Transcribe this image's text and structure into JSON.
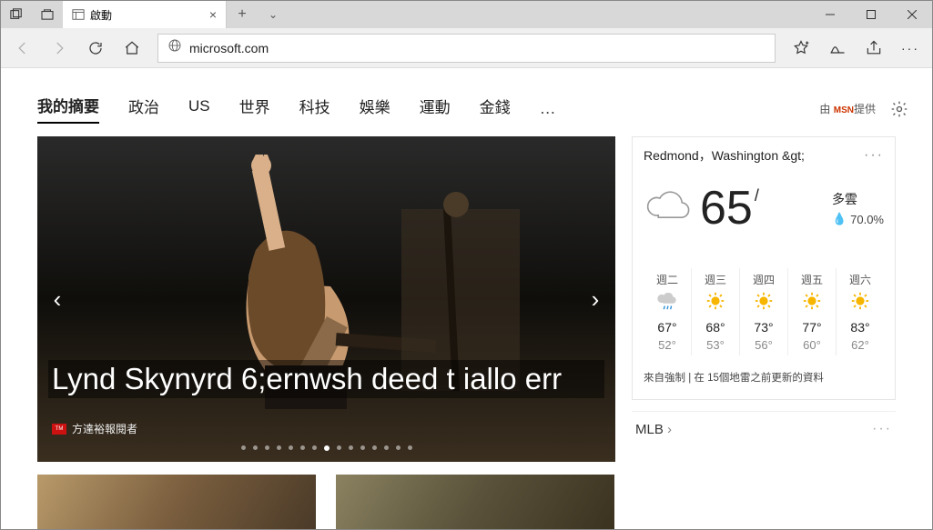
{
  "window": {
    "tab_title": "啟動"
  },
  "toolbar": {
    "url": "microsoft.com"
  },
  "nav": {
    "items": [
      "我的摘要",
      "政治",
      "US",
      "世界",
      "科技",
      "娛樂",
      "運動",
      "金錢"
    ],
    "more": "…",
    "provider_prefix": "由 ",
    "provider_brand": "MSN",
    "provider_suffix": "提供"
  },
  "hero": {
    "headline": "Lynd Skynyrd 6;ernwsh deed t iallo err",
    "source": "方達裕報閱者"
  },
  "weather": {
    "location": "Redmond，Washington &gt;",
    "temp": "65",
    "deg": "/",
    "condition": "多雲",
    "precip": "70.0%",
    "forecast": [
      {
        "day": "週二",
        "icon": "rain",
        "hi": "67°",
        "lo": "52°"
      },
      {
        "day": "週三",
        "icon": "sun",
        "hi": "68°",
        "lo": "53°"
      },
      {
        "day": "週四",
        "icon": "sun",
        "hi": "73°",
        "lo": "56°"
      },
      {
        "day": "週五",
        "icon": "sun",
        "hi": "77°",
        "lo": "60°"
      },
      {
        "day": "週六",
        "icon": "sun",
        "hi": "83°",
        "lo": "62°"
      }
    ],
    "footer": "來自強制 | 在 15個地雷之前更新的資料"
  },
  "sports": {
    "label": "MLB"
  }
}
